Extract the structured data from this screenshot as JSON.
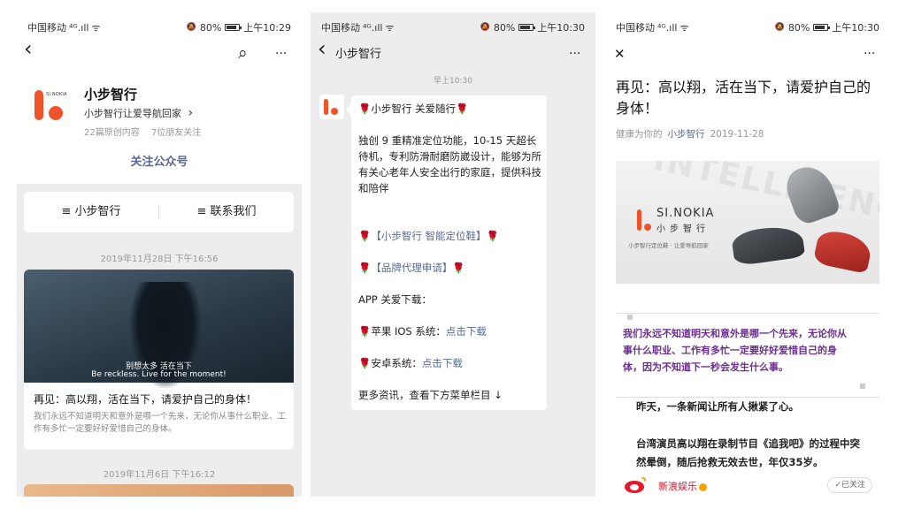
{
  "status": {
    "carrier": "中国移动",
    "signal": "⁴ᴳ.ıll",
    "wifi": "ᯤ",
    "mute": "🔕",
    "battery": "80%",
    "times": [
      "上午10:29",
      "上午10:30",
      "上午10:30"
    ]
  },
  "profile": {
    "name": "小步智行",
    "slogan": "小步智行让爱导航回家",
    "slogan_chevron": "›",
    "articles": "22篇原创内容",
    "friends": "7位朋友关注",
    "follow_label": "关注公众号",
    "logo_text": "SI.NOKIA",
    "menu": [
      "≡  小步智行",
      "≡  联系我们"
    ],
    "feed": [
      {
        "date": "2019年11月28日 下午16:56",
        "cover_caption_cn": "别想太多  活在当下",
        "cover_caption_en": "Be reckless. Live for the moment!",
        "title": "再见：高以翔，活在当下，请爱护自己的身体！",
        "desc": "我们永远不知道明天和意外是哪一个先来，无论你从事什么职业、工作有多忙一定要好好爱惜自己的身体。"
      }
    ],
    "next_date": "2019年11月6日 下午16:12"
  },
  "chat": {
    "title": "小步智行",
    "time": "早上10:30",
    "lines": [
      {
        "rose": "🌹",
        "text": "小步智行 关爱随行",
        "rose_end": "🌹",
        "link": false
      },
      {
        "text": "独创 9 重精准定位功能，10-15 天超长待机，专利防滑耐磨防崴设计，能够为所有关心老年人安全出行的家庭，提供科技和陪伴"
      },
      {
        "rose": "🌹",
        "text": "【小步智行 智能定位鞋】",
        "rose_end": "🌹",
        "link": true
      },
      {
        "rose": "🌹",
        "text": "【品牌代理申请】",
        "rose_end": "🌹",
        "link": true
      },
      {
        "text": "APP 关爱下载："
      },
      {
        "rose": "🌹",
        "label": "苹果 IOS 系统：",
        "link_text": "点击下载"
      },
      {
        "rose": "🌹",
        "label": "安卓系统：",
        "link_text": "点击下载"
      },
      {
        "text": "更多资讯，查看下方菜单栏目 ↓"
      }
    ]
  },
  "article": {
    "title": "再见：高以翔，活在当下，请爱护自己的身体！",
    "meta_prefix": "健康为你的",
    "meta_account": "小步智行",
    "meta_date": "2019-11-28",
    "banner_watermark": "INTELLIGENCE",
    "banner_brand": "SI.NOKIA",
    "banner_brand_cn": "小步智行",
    "banner_sub": "小步智行定位鞋 · 让爱导航回家",
    "quote": "我们永远不知道明天和意外是哪一个先来，无论你从事什么职业、工作有多忙一定要好好爱惜自己的身体，因为不知道下一秒会发生什么事。",
    "para1": "昨天，一条新闻让所有人揪紧了心。",
    "para2": "台湾演员高以翔在录制节目《追我吧》的过程中突然晕倒，随后抢救无效去世，年仅35岁。",
    "source_name": "新浪娱乐",
    "followed_label": "✓已关注"
  },
  "icons": {
    "back": "‹",
    "search": "⌕",
    "more": "···",
    "close": "✕"
  },
  "colors": {
    "brand_orange": "#f0532a",
    "link_blue": "#576b95",
    "quote_purple": "#6b2d8f",
    "weibo_red": "#e6162d"
  }
}
